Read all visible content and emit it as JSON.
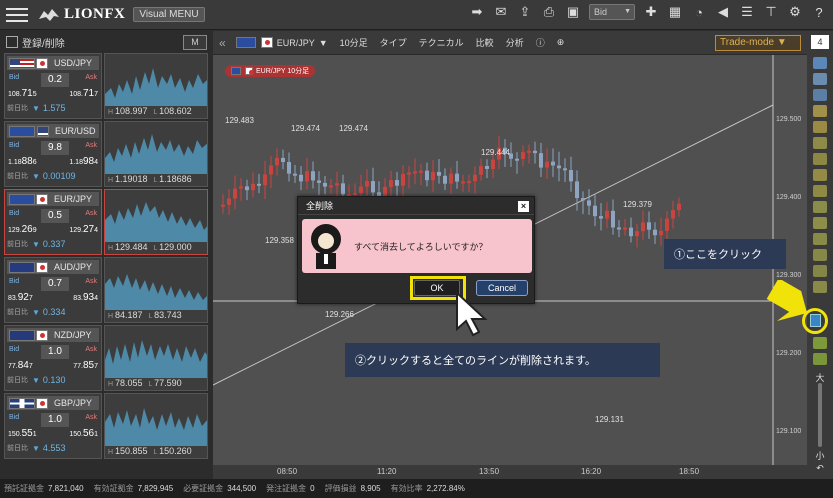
{
  "app": {
    "logo_text": "LIONFX",
    "visual_menu": "Visual MENU",
    "bid_select": "Bid"
  },
  "left_panel": {
    "title": "登録/削除",
    "m_button": "M",
    "pairs": [
      {
        "name": "USD/JPY",
        "bid_label": "Bid",
        "ask_label": "Ask",
        "spread": "0.2",
        "bid_prefix": "108.",
        "bid_main": "71",
        "bid_sup": "5",
        "ask_prefix": "108.",
        "ask_main": "71",
        "ask_sup": "7",
        "change_label": "前日比",
        "change": "1.575",
        "high": "108.997",
        "low": "108.602"
      },
      {
        "name": "EUR/USD",
        "bid_label": "Bid",
        "ask_label": "Ask",
        "spread": "9.8",
        "bid_prefix": "1.18",
        "bid_main": "88",
        "bid_sup": "6",
        "ask_prefix": "1.18",
        "ask_main": "98",
        "ask_sup": "4",
        "change_label": "前日比",
        "change": "0.00109",
        "high": "1.19018",
        "low": "1.18686"
      },
      {
        "name": "EUR/JPY",
        "bid_label": "Bid",
        "ask_label": "Ask",
        "spread": "0.5",
        "bid_prefix": "129.",
        "bid_main": "26",
        "bid_sup": "9",
        "ask_prefix": "129.",
        "ask_main": "27",
        "ask_sup": "4",
        "change_label": "前日比",
        "change": "0.337",
        "high": "129.484",
        "low": "129.000"
      },
      {
        "name": "AUD/JPY",
        "bid_label": "Bid",
        "ask_label": "Ask",
        "spread": "0.7",
        "bid_prefix": "83.",
        "bid_main": "92",
        "bid_sup": "7",
        "ask_prefix": "83.",
        "ask_main": "93",
        "ask_sup": "4",
        "change_label": "前日比",
        "change": "0.334",
        "high": "84.187",
        "low": "83.743"
      },
      {
        "name": "NZD/JPY",
        "bid_label": "Bid",
        "ask_label": "Ask",
        "spread": "1.0",
        "bid_prefix": "77.",
        "bid_main": "84",
        "bid_sup": "7",
        "ask_prefix": "77.",
        "ask_main": "85",
        "ask_sup": "7",
        "change_label": "前日比",
        "change": "0.130",
        "high": "78.055",
        "low": "77.590"
      },
      {
        "name": "GBP/JPY",
        "bid_label": "Bid",
        "ask_label": "Ask",
        "spread": "1.0",
        "bid_prefix": "150.",
        "bid_main": "55",
        "bid_sup": "1",
        "ask_prefix": "150.",
        "ask_main": "56",
        "ask_sup": "1",
        "change_label": "前日比",
        "change": "4.553",
        "high": "150.855",
        "low": "150.260"
      }
    ]
  },
  "chart_toolbar": {
    "pair": "EUR/JPY",
    "timeframe": "10分足",
    "type": "タイプ",
    "technical": "テクニカル",
    "compare": "比較",
    "analysis": "分析",
    "trade_mode": "Trade-mode"
  },
  "chart": {
    "tag": "EUR/JPY 10分足",
    "price_labels": [
      "129.483",
      "129.474",
      "129.474",
      "129.444",
      "129.379",
      "129.358",
      "129.266",
      "129.131"
    ],
    "y_ticks": [
      "129.500",
      "129.400",
      "129.300",
      "129.200",
      "129.100"
    ],
    "x_ticks": [
      "08:50",
      "11:20",
      "13:50",
      "16:20",
      "18:50"
    ]
  },
  "right_strip": {
    "num_box": "4"
  },
  "modal": {
    "title": "全削除",
    "close": "×",
    "message": "すべて消去してよろしいですか？",
    "ok_label": "OK",
    "cancel_label": "Cancel"
  },
  "annotations": {
    "callout1": "①ここをクリック",
    "callout2": "②クリックすると全てのラインが削除されます。"
  },
  "status_bar": [
    {
      "label": "預託証拠金",
      "value": "7,821,040"
    },
    {
      "label": "有効証拠金",
      "value": "7,829,945"
    },
    {
      "label": "必要証拠金",
      "value": "344,500"
    },
    {
      "label": "発注証拠金",
      "value": "0"
    },
    {
      "label": "評価損益",
      "value": "8,905"
    },
    {
      "label": "有効比率",
      "value": "2,272.84%"
    }
  ],
  "colors": {
    "highlight": "#f1e20a",
    "callout_bg": "#2d3a55",
    "modal_body": "#f7c3cc",
    "bull": "#c8453f",
    "bear": "#8ea4c0"
  }
}
